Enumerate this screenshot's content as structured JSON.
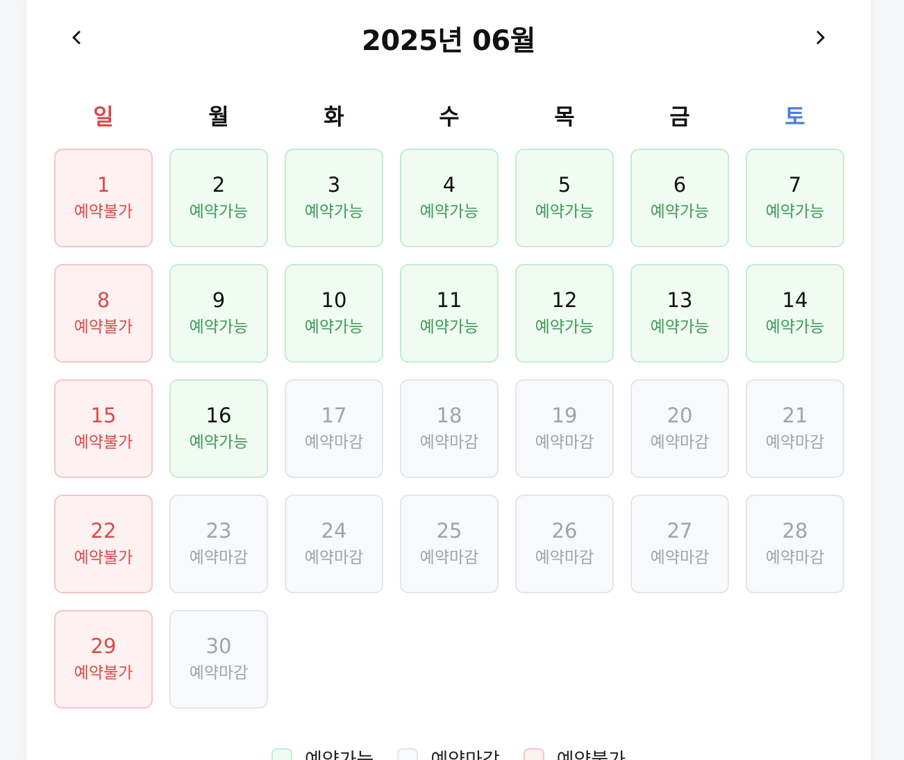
{
  "calendar": {
    "title": "2025년 06월",
    "prev_icon": "chevron-left-icon",
    "next_icon": "chevron-right-icon",
    "weekdays": [
      "일",
      "월",
      "화",
      "수",
      "목",
      "금",
      "토"
    ],
    "colors": {
      "sunday": "#dc4a4a",
      "saturday": "#4b7be5",
      "available": "#3d9a55",
      "closed": "#9ea3ad",
      "blocked": "#d94b4b"
    },
    "days": [
      {
        "day": "1",
        "status": "예약불가",
        "type": "blocked"
      },
      {
        "day": "2",
        "status": "예약가능",
        "type": "available"
      },
      {
        "day": "3",
        "status": "예약가능",
        "type": "available"
      },
      {
        "day": "4",
        "status": "예약가능",
        "type": "available"
      },
      {
        "day": "5",
        "status": "예약가능",
        "type": "available"
      },
      {
        "day": "6",
        "status": "예약가능",
        "type": "available"
      },
      {
        "day": "7",
        "status": "예약가능",
        "type": "available"
      },
      {
        "day": "8",
        "status": "예약불가",
        "type": "blocked"
      },
      {
        "day": "9",
        "status": "예약가능",
        "type": "available"
      },
      {
        "day": "10",
        "status": "예약가능",
        "type": "available"
      },
      {
        "day": "11",
        "status": "예약가능",
        "type": "available"
      },
      {
        "day": "12",
        "status": "예약가능",
        "type": "available"
      },
      {
        "day": "13",
        "status": "예약가능",
        "type": "available"
      },
      {
        "day": "14",
        "status": "예약가능",
        "type": "available"
      },
      {
        "day": "15",
        "status": "예약불가",
        "type": "blocked"
      },
      {
        "day": "16",
        "status": "예약가능",
        "type": "available"
      },
      {
        "day": "17",
        "status": "예약마감",
        "type": "closed"
      },
      {
        "day": "18",
        "status": "예약마감",
        "type": "closed"
      },
      {
        "day": "19",
        "status": "예약마감",
        "type": "closed"
      },
      {
        "day": "20",
        "status": "예약마감",
        "type": "closed"
      },
      {
        "day": "21",
        "status": "예약마감",
        "type": "closed"
      },
      {
        "day": "22",
        "status": "예약불가",
        "type": "blocked"
      },
      {
        "day": "23",
        "status": "예약마감",
        "type": "closed"
      },
      {
        "day": "24",
        "status": "예약마감",
        "type": "closed"
      },
      {
        "day": "25",
        "status": "예약마감",
        "type": "closed"
      },
      {
        "day": "26",
        "status": "예약마감",
        "type": "closed"
      },
      {
        "day": "27",
        "status": "예약마감",
        "type": "closed"
      },
      {
        "day": "28",
        "status": "예약마감",
        "type": "closed"
      },
      {
        "day": "29",
        "status": "예약불가",
        "type": "blocked"
      },
      {
        "day": "30",
        "status": "예약마감",
        "type": "closed"
      }
    ]
  },
  "legend": [
    {
      "label": "예약가능",
      "type": "available"
    },
    {
      "label": "예약마감",
      "type": "closed"
    },
    {
      "label": "예약불가",
      "type": "blocked"
    }
  ]
}
